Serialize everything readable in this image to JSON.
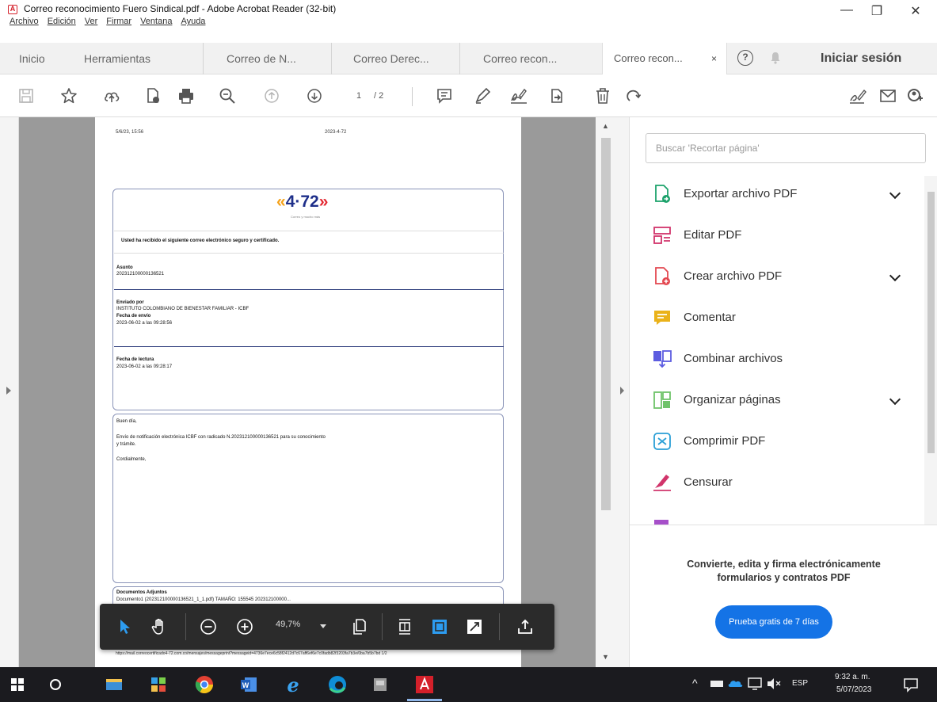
{
  "window": {
    "title": "Correo reconocimiento Fuero Sindical.pdf - Adobe Acrobat Reader (32-bit)",
    "menu": [
      "Archivo",
      "Edición",
      "Ver",
      "Firmar",
      "Ventana",
      "Ayuda"
    ],
    "minimize": "—",
    "maximize": "❐",
    "close": "✕"
  },
  "tabs": {
    "inicio": "Inicio",
    "herramientas": "Herramientas",
    "doc_tabs": [
      "Correo de N...",
      "Correo Derec...",
      "Correo recon...",
      "Correo recon..."
    ],
    "close_glyph": "×",
    "signin": "Iniciar sesión"
  },
  "toolbar": {
    "page_current": "1",
    "page_total": "/ 2"
  },
  "document": {
    "header_left": "5/6/23, 15:56",
    "header_right": "2023-4-72",
    "logo_left": "«",
    "logo_num": "4·72",
    "logo_right": "»",
    "logo_sub": "Correo y mucho más",
    "intro": "Usted ha recibido el siguiente correo electrónico seguro y certificado.",
    "asunto_label": "Asunto",
    "asunto_value": "202312100000136521",
    "enviado_label": "Enviado por",
    "enviado_value": "INSTITUTO COLOMBIANO DE BIENESTAR FAMILIAR - ICBF",
    "fecha_envio_label": "Fecha de envío",
    "fecha_envio_value": "2023-06-02 a las 09:28:56",
    "fecha_lectura_label": "Fecha de lectura",
    "fecha_lectura_value": "2023-06-02 a las 09:28:17",
    "body_1": "Buen día,",
    "body_2": "Envío de notificación electrónica ICBF con radicado N.202312100000136521 para su conocimiento",
    "body_3": "y trámite.",
    "body_4": "Cordialmente,",
    "adjuntos_label": "Documentos Adjuntos",
    "adjuntos_value": "Documento1 (202312100000136521_1_1.pdf) TAMAÑO: 155545 202312100000...",
    "footer_url": "https://mail.correocertificado4-72.com.co/mensajes/messageprint?messageid=4736e7ece6c58f2412d7c67aff6ef6e7c0fadb82f3203fa7b3e/0ba7b5b7bd   1/2"
  },
  "floatbar": {
    "zoom": "49,7%"
  },
  "panel": {
    "search_placeholder": "Buscar 'Recortar página'",
    "tools": [
      {
        "label": "Exportar archivo PDF",
        "color": "#1ca26b",
        "expand": true
      },
      {
        "label": "Editar PDF",
        "color": "#d1346b",
        "expand": false
      },
      {
        "label": "Crear archivo PDF",
        "color": "#e34850",
        "expand": true
      },
      {
        "label": "Comentar",
        "color": "#eab21a",
        "expand": false
      },
      {
        "label": "Combinar archivos",
        "color": "#5c5ce0",
        "expand": false
      },
      {
        "label": "Organizar páginas",
        "color": "#6fc36a",
        "expand": true
      },
      {
        "label": "Comprimir PDF",
        "color": "#2a9fd6",
        "expand": false
      },
      {
        "label": "Censurar",
        "color": "#d1346b",
        "expand": false
      }
    ],
    "promo_line1": "Convierte, edita y firma electrónicamente",
    "promo_line2": "formularios y contratos PDF",
    "promo_button": "Prueba gratis de 7 días"
  },
  "taskbar": {
    "lang": "ESP",
    "time": "9:32 a. m.",
    "date": "5/07/2023"
  }
}
